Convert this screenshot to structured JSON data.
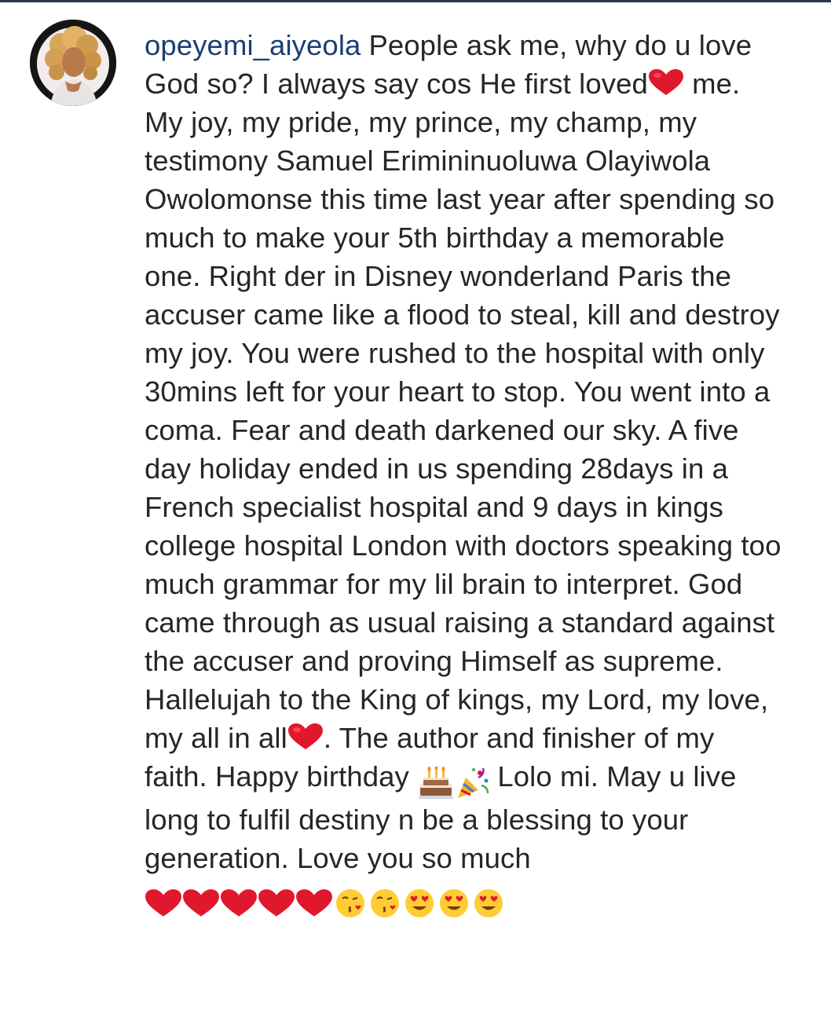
{
  "post": {
    "username": "opeyemi_aiyeola",
    "caption_parts": {
      "p1": "People ask me, why do u love God so? I always say cos He first loved",
      "p2": " me. My joy, my pride, my prince, my champ, my testimony Samuel Erimininuoluwa Olayiwola Owolomonse this time last year after spending so much to make your 5th birthday a memorable one. Right der in Disney wonderland Paris the accuser came like a flood to steal, kill and destroy my joy. You were rushed to the hospital with only 30mins left for your heart to stop. You went into a coma. Fear and death darkened our sky. A five day holiday ended in us spending 28days in a French specialist hospital and 9 days in kings college hospital London with doctors speaking too much grammar for my lil brain to interpret. God came through as usual raising a standard against the accuser and proving Himself as supreme. Hallelujah to the King of kings, my Lord, my love, my all in all",
      "p3": ". The author and finisher of my faith. Happy birthday ",
      "p4": " Lolo mi. May u live long to fulfil destiny n be a blessing to your generation. Love you so much "
    },
    "emojis": {
      "heart": "red-heart",
      "cake": "birthday-cake",
      "party": "party-popper",
      "kiss": "face-blowing-kiss",
      "heart_eyes": "smiling-face-with-heart-eyes"
    }
  },
  "colors": {
    "username": "#1a3f74",
    "text": "#262626",
    "heart": "#e0182d",
    "emoji_face": "#ffcc33"
  }
}
